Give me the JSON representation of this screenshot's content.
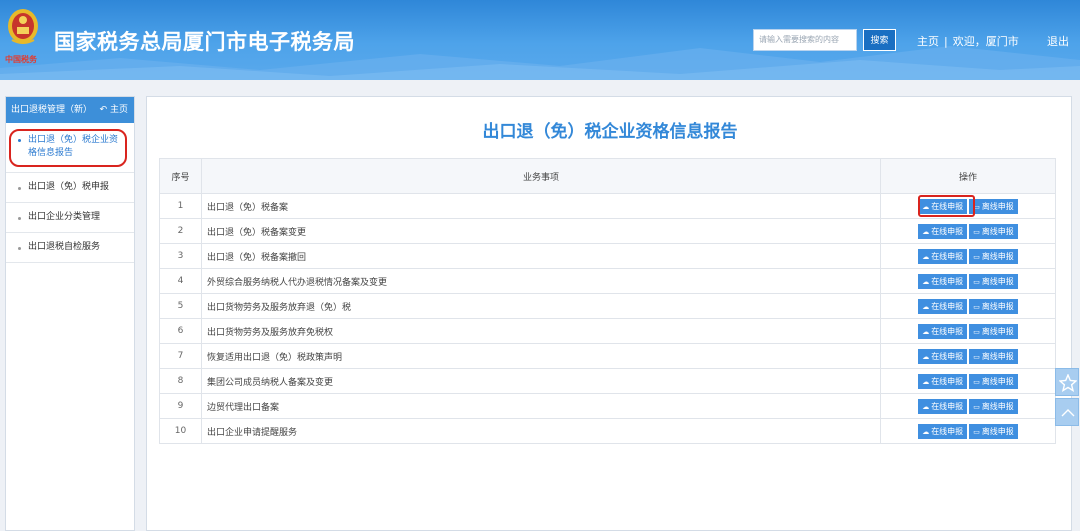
{
  "header": {
    "title": "国家税务总局厦门市电子税务局",
    "emblem_subtext": "中国税务",
    "search_placeholder": "请输入需要搜索的内容",
    "search_button": "搜索",
    "nav_home": "主页",
    "nav_separator": "|",
    "nav_welcome": "欢迎，厦门市",
    "logout": "退出",
    "emblem_icon": "tax-emblem-icon"
  },
  "sidebar": {
    "header_title": "出口退税管理（新）",
    "home_link": "主页",
    "items": [
      {
        "label": "出口退（免）税企业资格信息报告",
        "active": true
      },
      {
        "label": "出口退（免）税申报",
        "active": false
      },
      {
        "label": "出口企业分类管理",
        "active": false
      },
      {
        "label": "出口退税自检服务",
        "active": false
      }
    ]
  },
  "main": {
    "title": "出口退（免）税企业资格信息报告",
    "columns": [
      "序号",
      "业务事项",
      "操作"
    ],
    "online_label": "在线申报",
    "offline_label": "离线申报",
    "rows": [
      {
        "no": "1",
        "name": "出口退（免）税备案"
      },
      {
        "no": "2",
        "name": "出口退（免）税备案变更"
      },
      {
        "no": "3",
        "name": "出口退（免）税备案撤回"
      },
      {
        "no": "4",
        "name": "外贸综合服务纳税人代办退税情况备案及变更"
      },
      {
        "no": "5",
        "name": "出口货物劳务及服务放弃退（免）税"
      },
      {
        "no": "6",
        "name": "出口货物劳务及服务放弃免税权"
      },
      {
        "no": "7",
        "name": "恢复适用出口退（免）税政策声明"
      },
      {
        "no": "8",
        "name": "集团公司成员纳税人备案及变更"
      },
      {
        "no": "9",
        "name": "边贸代理出口备案"
      },
      {
        "no": "10",
        "name": "出口企业申请提醒服务"
      }
    ]
  },
  "colors": {
    "header_blue": "#2f87d8",
    "accent_blue": "#3388d8",
    "button_blue": "#3f8fe0",
    "highlight_red": "#d9241e"
  }
}
